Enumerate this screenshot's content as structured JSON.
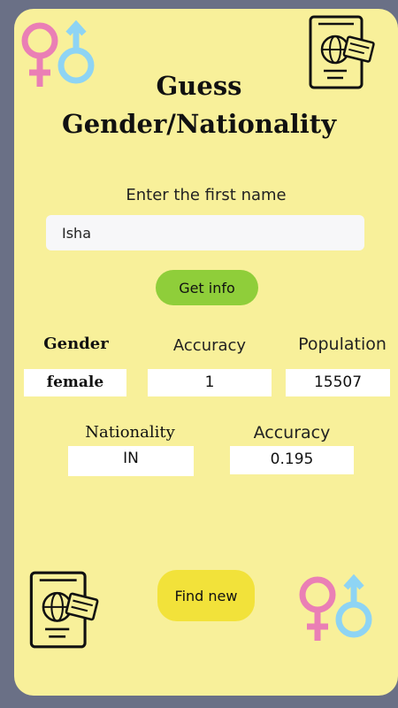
{
  "title_line1": "Guess",
  "title_line2": "Gender/Nationality",
  "prompt": "Enter the first name",
  "name_input": {
    "value": "Isha",
    "placeholder": ""
  },
  "get_info_label": "Get info",
  "gender": {
    "header": "Gender",
    "value": "female"
  },
  "gender_accuracy": {
    "header": "Accuracy",
    "value": "1"
  },
  "population": {
    "header": "Population",
    "value": "15507"
  },
  "nationality": {
    "header": "Nationality",
    "value": "IN"
  },
  "nationality_accuracy": {
    "header": "Accuracy",
    "value": "0.195"
  },
  "find_new_label": "Find new",
  "icons": [
    "gender-symbols-icon",
    "passport-icon",
    "passport-icon",
    "gender-symbols-icon"
  ],
  "colors": {
    "background": "#6a7086",
    "card": "#f8f09a",
    "get_info_button": "#8fce3a",
    "find_new_button": "#f2e23a",
    "female_symbol": "#ea7fb5",
    "male_symbol": "#8ed4f4"
  }
}
